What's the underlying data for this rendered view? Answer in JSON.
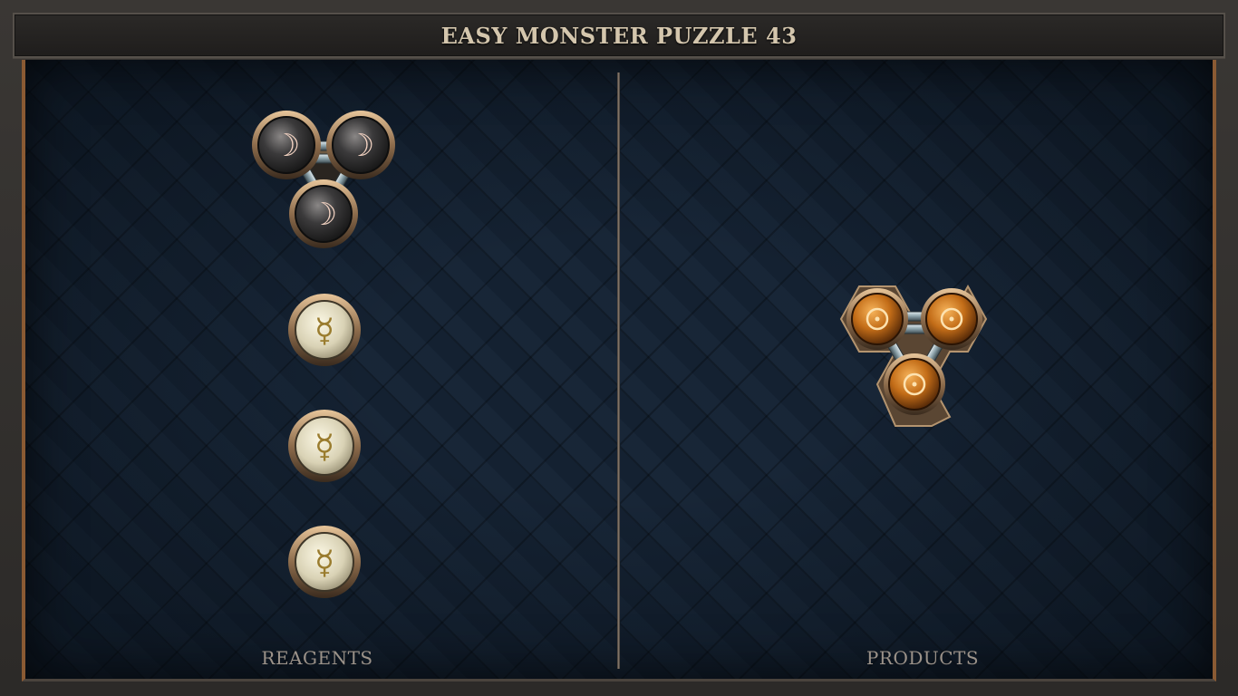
{
  "title": "EASY MONSTER PUZZLE 43",
  "panels": {
    "reagents_label": "REAGENTS",
    "products_label": "PRODUCTS"
  },
  "reagents": [
    {
      "kind": "molecule",
      "element": "silver",
      "symbol": "☽",
      "atoms": 3,
      "bonds": 3
    },
    {
      "kind": "atom",
      "element": "quicksilver",
      "symbol": "☿"
    },
    {
      "kind": "atom",
      "element": "quicksilver",
      "symbol": "☿"
    },
    {
      "kind": "atom",
      "element": "quicksilver",
      "symbol": "☿"
    }
  ],
  "products": [
    {
      "kind": "molecule",
      "element": "gold",
      "symbol": "☉",
      "atoms": 3,
      "bonds": 3
    }
  ],
  "colors": {
    "frame": "#3a3734",
    "board": "#142131",
    "accent_copper": "#8a5a33",
    "title_text": "#d4c6ad",
    "label_text": "#9b9289",
    "silver_glyph": "#f3d3c2",
    "quicksilver_orb": "#d8d2b8",
    "gold_orb": "#c8771c"
  }
}
